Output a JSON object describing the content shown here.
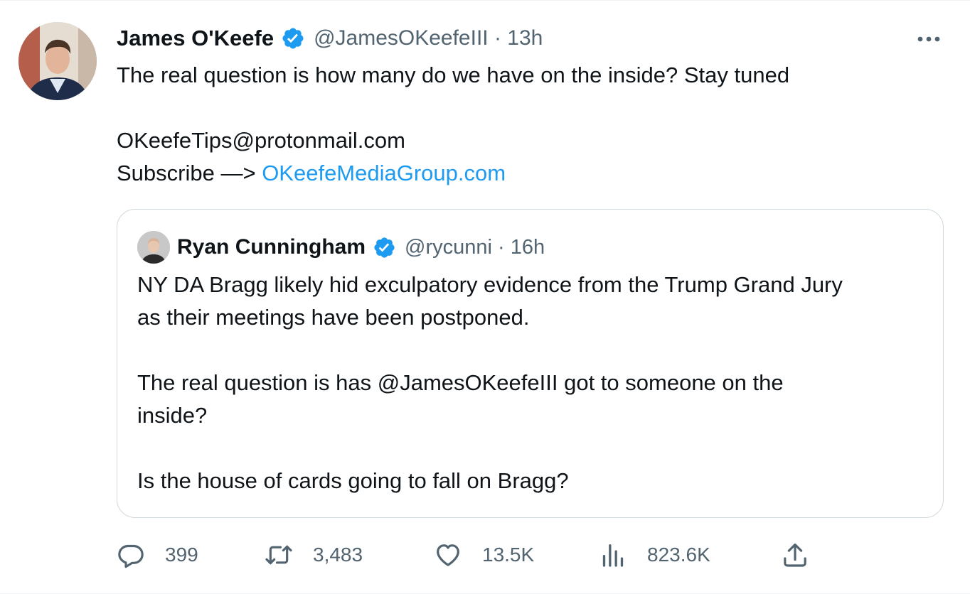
{
  "tweet": {
    "author_name": "James O'Keefe",
    "author_handle": "@JamesOKeefeIII",
    "separator": " · ",
    "time": "13h",
    "text_lines": [
      "The real question is how many do we have on the inside? Stay tuned",
      "",
      "OKeefeTips@protonmail.com"
    ],
    "subscribe_prefix": "Subscribe —> ",
    "subscribe_link": "OKeefeMediaGroup.com"
  },
  "quote": {
    "author_name": "Ryan Cunningham",
    "author_handle": "@rycunni",
    "separator": " · ",
    "time": "16h",
    "text_lines": [
      "NY DA Bragg likely hid exculpatory evidence from the Trump Grand Jury",
      "as their meetings have been postponed.",
      "",
      "The real question is has @JamesOKeefeIII got to someone on the",
      "inside?",
      "",
      "Is the house of cards going to fall on Bragg?"
    ]
  },
  "actions": {
    "replies": "399",
    "retweets": "3,483",
    "likes": "13.5K",
    "views": "823.6K"
  },
  "colors": {
    "accent": "#1d9bf0",
    "secondary_text": "#536471",
    "border": "#cfd9de"
  },
  "icons": {
    "verified": "verified-badge-icon",
    "more": "more-dots-icon",
    "reply": "reply-bubble-icon",
    "retweet": "retweet-icon",
    "like": "heart-icon",
    "views": "views-bars-icon",
    "share": "share-upload-icon"
  }
}
